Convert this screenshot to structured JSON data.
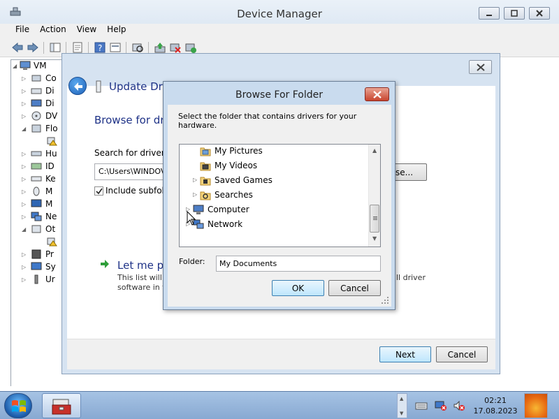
{
  "device_manager": {
    "title": "Device Manager",
    "menu": [
      "File",
      "Action",
      "View",
      "Help"
    ],
    "tree_root": "VM",
    "tree_items": [
      "Co",
      "Di",
      "Di",
      "DV",
      "Flo",
      "Hu",
      "ID",
      "Ke",
      "M",
      "M",
      "Ne",
      "Ot",
      "Pr",
      "Sy",
      "Ur"
    ]
  },
  "update_driver": {
    "title": "Update Driv",
    "heading": "Browse for dri",
    "search_label": "Search for driver sc",
    "path_value": "C:\\Users\\WINDOV",
    "browse_button": "se...",
    "include_subfolders": "Include subfold",
    "include_checked": true,
    "let_me_pick": "Let me pi",
    "list_text": "This list will s",
    "list_text_right": "ll driver",
    "software_text": "software in t",
    "next_button": "Next",
    "cancel_button": "Cancel"
  },
  "browse_folder": {
    "title": "Browse For Folder",
    "instruction": "Select the folder that contains drivers for your hardware.",
    "items": [
      {
        "label": "My Pictures",
        "icon": "pictures-folder-icon",
        "expandable": false
      },
      {
        "label": "My Videos",
        "icon": "videos-folder-icon",
        "expandable": false
      },
      {
        "label": "Saved Games",
        "icon": "saved-games-folder-icon",
        "expandable": true
      },
      {
        "label": "Searches",
        "icon": "searches-folder-icon",
        "expandable": true
      },
      {
        "label": "Computer",
        "icon": "computer-icon",
        "expandable": true
      },
      {
        "label": "Network",
        "icon": "network-icon",
        "expandable": true
      }
    ],
    "folder_label": "Folder:",
    "folder_value": "My Documents",
    "ok_button": "OK",
    "cancel_button": "Cancel"
  },
  "taskbar": {
    "time": "02:21",
    "date": "17.08.2023"
  },
  "colors": {
    "title_blue": "#1e3287",
    "close_red": "#c8442e",
    "taskbar": "#a6c3e4"
  }
}
